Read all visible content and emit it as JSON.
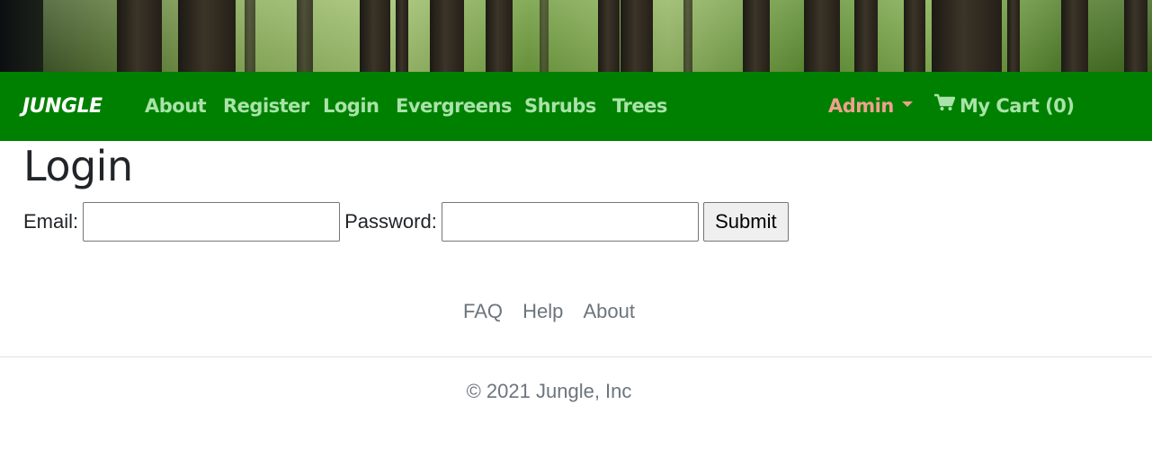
{
  "navbar": {
    "brand": "JUNGLE",
    "links": [
      "About",
      "Register",
      "Login",
      "Evergreens",
      "Shrubs",
      "Trees"
    ],
    "admin_label": "Admin",
    "cart_label": "My Cart (0)",
    "bg_color": "#008000",
    "link_color": "#a9e3a9",
    "admin_color": "#f0a08e"
  },
  "main": {
    "title": "Login",
    "email_label": "Email:",
    "email_value": "",
    "password_label": "Password:",
    "password_value": "",
    "submit_label": "Submit"
  },
  "footer": {
    "links": [
      "FAQ",
      "Help",
      "About"
    ],
    "copyright": "© 2021 Jungle, Inc"
  },
  "icons": {
    "cart": "shopping-cart-icon",
    "caret": "caret-down-icon"
  }
}
